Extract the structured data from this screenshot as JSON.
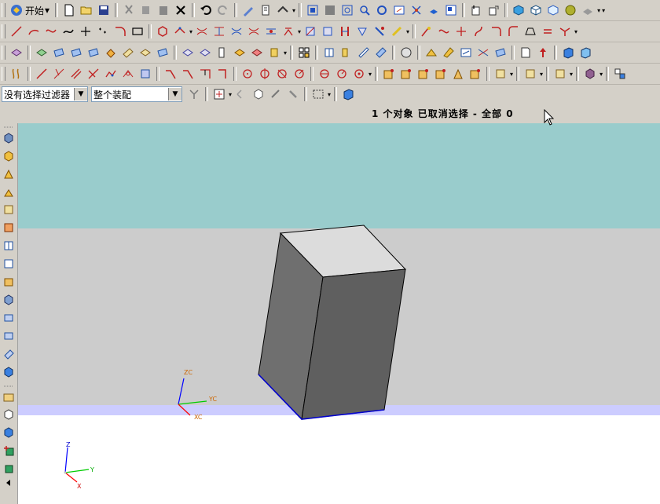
{
  "app": {
    "start_menu_label": "开始"
  },
  "selection_bar": {
    "type_filter": "没有选择过滤器",
    "scope": "整个装配"
  },
  "status": {
    "message": "1 个对象 已取消选择  - 全部 0"
  },
  "viewport": {
    "colors": {
      "band_top": "#99cccc",
      "band_mid": "#cccccc",
      "band_strip": "#ccccff",
      "band_bottom": "#ffffff",
      "solid_top_face": "#dcdcdc",
      "solid_left_face": "#6f6f6f",
      "solid_right_face": "#5f5f5f",
      "highlight_edge": "#0000cc"
    },
    "wcs_axis_labels": {
      "x": "XC",
      "y": "YC",
      "z": "ZC"
    },
    "abs_axis_labels": {
      "x": "X",
      "y": "Y",
      "z": "Z"
    }
  },
  "toolbars": {
    "row1_icons": [
      "new-file-icon",
      "open-folder-icon",
      "save-icon",
      "cut-icon",
      "copy-icon",
      "paste-icon",
      "delete-icon",
      "undo-icon",
      "redo-icon",
      "edit-object-icon",
      "info-icon",
      "display-icon",
      "fit-view-icon",
      "zoom-window-icon",
      "zoom-icon",
      "rotate-icon",
      "pan-icon",
      "snap-view-icon",
      "shaded-icon",
      "wireframe-icon",
      "part-nav-icon",
      "assembly-icon",
      "solid-cube-icon",
      "cube-icon",
      "wire-cube-icon",
      "sphere-icon",
      "layer-icon"
    ],
    "row2_icons": [
      "line-icon",
      "arc-icon",
      "spline-icon",
      "curve-icon",
      "cross-icon",
      "point-set-icon",
      "fillet-icon",
      "rectangle-icon",
      "polygon-icon",
      "offset-curve-icon",
      "trim-icon",
      "extend-icon",
      "bridge-icon",
      "project-curve-icon",
      "wrap-icon",
      "helix-icon",
      "intersect-icon",
      "section-icon",
      "text-icon",
      "combine-icon",
      "join-icon",
      "split-curve-icon",
      "trim-corner-icon",
      "divide-icon",
      "chamfer-curve-icon",
      "edit-curve-icon",
      "lengthen-icon",
      "corner-icon",
      "curve-length-icon",
      "smooth-icon",
      "bend-icon"
    ],
    "row3_icons": [
      "extrude-icon",
      "revolve-icon",
      "sweep-icon",
      "tube-icon",
      "boss-icon",
      "pocket-icon",
      "pad-icon",
      "slot-icon",
      "groove-icon",
      "thread-icon",
      "hole-icon",
      "rib-icon",
      "edge-blend-icon",
      "chamfer-icon",
      "shell-icon",
      "draft-icon",
      "pattern-icon",
      "mirror-icon",
      "sew-icon",
      "patch-icon",
      "trim-body-icon",
      "split-body-icon",
      "thicken-icon",
      "scale-icon",
      "offset-face-icon",
      "extract-icon",
      "wave-link-icon",
      "replace-face-icon",
      "simplify-icon",
      "emboss-icon",
      "surface-icon",
      "arrow-up-icon",
      "block-icon",
      "cylinder-icon"
    ],
    "row4_icons": [
      "point-icon",
      "line-constraint-icon",
      "parallel-icon",
      "perpendicular-icon",
      "tangent-icon",
      "coincident-icon",
      "fixed-icon",
      "arc-constraint-icon",
      "angle-icon",
      "horizontal-icon",
      "vertical-icon",
      "dim-circle-icon",
      "dim-point-icon",
      "dim-angle-icon",
      "dim-radius-icon",
      "dim-linear-icon",
      "dim-chain-icon",
      "dim-ordinate-icon",
      "component-add-icon",
      "component-move-icon",
      "component-mate-icon",
      "component-replace-icon",
      "component-array-icon",
      "component-mirror-icon",
      "assembly-cut-icon",
      "assembly-clone-icon",
      "wave-geom-icon",
      "exploded-view-icon",
      "sequence-icon",
      "clearance-icon",
      "assembly-arrange-icon"
    ],
    "row5_icons": [
      "filter-icon",
      "snap-point-icon",
      "select-all-icon",
      "deselect-icon",
      "box-select-icon",
      "wrench-icon",
      "select-rect-icon",
      "view-cube-icon"
    ]
  }
}
